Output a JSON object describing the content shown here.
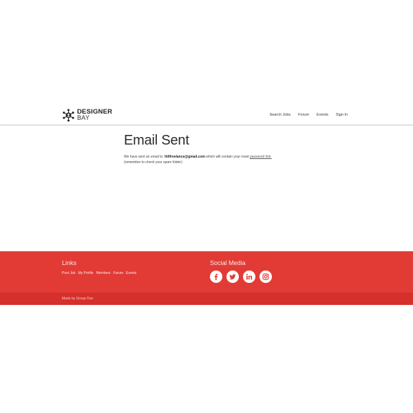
{
  "brand": {
    "line1": "DESIGNER",
    "line2": "BAY"
  },
  "nav": {
    "items": [
      "Search Jobs",
      "Forum",
      "Events",
      "Sign In"
    ]
  },
  "main": {
    "title": "Email Sent",
    "message_prefix": "We have sent an email to: ",
    "email": "hillfreelance@gmail.com",
    "message_mid": " which will contain your reset ",
    "message_link": "password link.",
    "note": "(remember to check your spam folder)"
  },
  "footer": {
    "links_heading": "Links",
    "links": [
      "Post Job",
      "My Profile",
      "Members",
      "Forum",
      "Events"
    ],
    "social_heading": "Social Media",
    "social_icons": [
      "facebook-icon",
      "twitter-icon",
      "linkedin-icon",
      "instagram-icon"
    ],
    "credit": "Made by Group One"
  },
  "colors": {
    "footer_red": "#e23b36",
    "subfooter_red": "#d5302b"
  }
}
